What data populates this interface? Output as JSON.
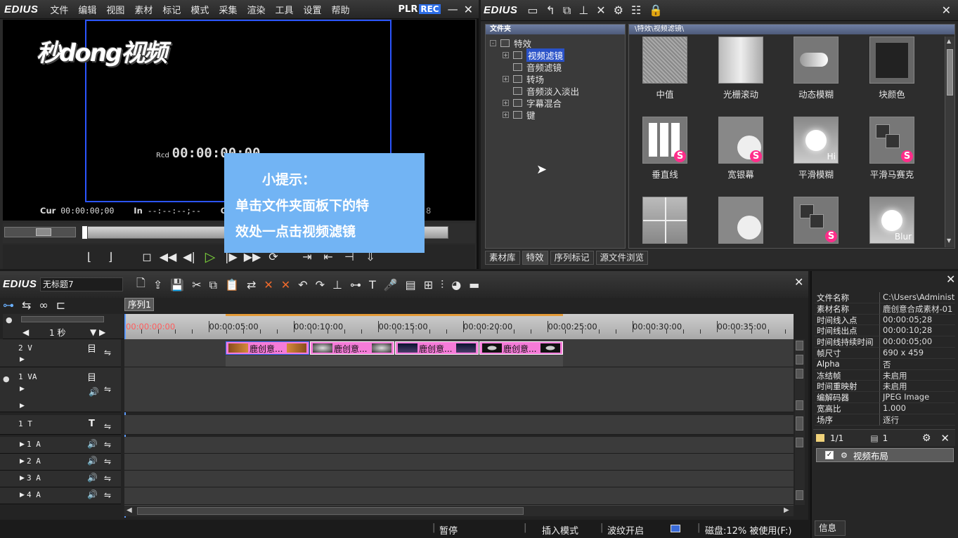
{
  "player": {
    "logo": "EDIUS",
    "menu": [
      "文件",
      "编辑",
      "视图",
      "素材",
      "标记",
      "模式",
      "采集",
      "渲染",
      "工具",
      "设置",
      "帮助"
    ],
    "plr_label": "PLR",
    "rec_label": "REC",
    "watermark": "秒dong视频",
    "rcd_label": "Rcd",
    "rcd_value": "00:00:00:00",
    "cur_label": "Cur",
    "cur_value": "00:00:00;00",
    "in_label": "In",
    "in_value": "--:--:--;--",
    "out_label": "Out",
    "right_digit": "8"
  },
  "bin": {
    "logo": "EDIUS",
    "folder_header": "文件夹",
    "effect_path": "\\特效\\视频滤镜\\",
    "tree": [
      {
        "label": "特效",
        "expand": "-",
        "indent": 0
      },
      {
        "label": "视频滤镜",
        "expand": "+",
        "indent": 1,
        "selected": true
      },
      {
        "label": "音频滤镜",
        "expand": "",
        "indent": 1
      },
      {
        "label": "转场",
        "expand": "+",
        "indent": 1
      },
      {
        "label": "音频淡入淡出",
        "expand": "",
        "indent": 1
      },
      {
        "label": "字幕混合",
        "expand": "+",
        "indent": 1
      },
      {
        "label": "键",
        "expand": "+",
        "indent": 1
      }
    ],
    "effects": [
      "中值",
      "光栅滚动",
      "动态模糊",
      "块颜色",
      "垂直线",
      "宽银幕",
      "平滑模糊",
      "平滑马赛克"
    ],
    "badges": {
      "s": "S",
      "hi": "Hi",
      "blur": "Blur"
    },
    "tabs": [
      "素材库",
      "特效",
      "序列标记",
      "源文件浏览"
    ]
  },
  "tip": {
    "line1": "小提示：",
    "line2": "单击文件夹面板下的特",
    "line3": "效处一点击视频滤镜"
  },
  "timeline": {
    "logo": "EDIUS",
    "title": "无标题7",
    "sequence_tab": "序列1",
    "scale_label": "1 秒",
    "ruler": [
      "00:00:00:00",
      "00:00:05:00",
      "00:00:10:00",
      "00:00:15:00",
      "00:00:20:00",
      "00:00:25:00",
      "00:00:30:00",
      "00:00:35:00"
    ],
    "tracks": [
      "2 V",
      "1 VA",
      "1 T",
      "1 A",
      "2 A",
      "3 A",
      "4 A"
    ],
    "clips": [
      "鹿创意...",
      "鹿创意...",
      "鹿创意...",
      "鹿创意..."
    ],
    "status": [
      "暂停",
      "插入模式",
      "波纹开启",
      "磁盘:12% 被使用(F:)"
    ]
  },
  "info": {
    "rows": [
      {
        "k": "文件名称",
        "v": "C:\\Users\\Administ..."
      },
      {
        "k": "素材名称",
        "v": "鹿创意合成素材-01"
      },
      {
        "k": "时间线入点",
        "v": "00:00:05;28"
      },
      {
        "k": "时间线出点",
        "v": "00:00:10;28"
      },
      {
        "k": "时间线持续时间",
        "v": "00:00:05;00"
      },
      {
        "k": "帧尺寸",
        "v": "690 x 459"
      },
      {
        "k": "Alpha",
        "v": "否"
      },
      {
        "k": "冻结帧",
        "v": "未启用"
      },
      {
        "k": "时间重映射",
        "v": "未启用"
      },
      {
        "k": "编解码器",
        "v": "JPEG Image"
      },
      {
        "k": "宽高比",
        "v": "1.000"
      },
      {
        "k": "场序",
        "v": "逐行"
      }
    ],
    "page_count": "1/1",
    "layer_count": "1",
    "layout_item": "视频布局",
    "tab": "信息"
  },
  "colors": {
    "accent": "#2b55ff",
    "tip_bg": "#72b4f4",
    "clip": "#f57bd8",
    "selection": "#2a52c8"
  }
}
